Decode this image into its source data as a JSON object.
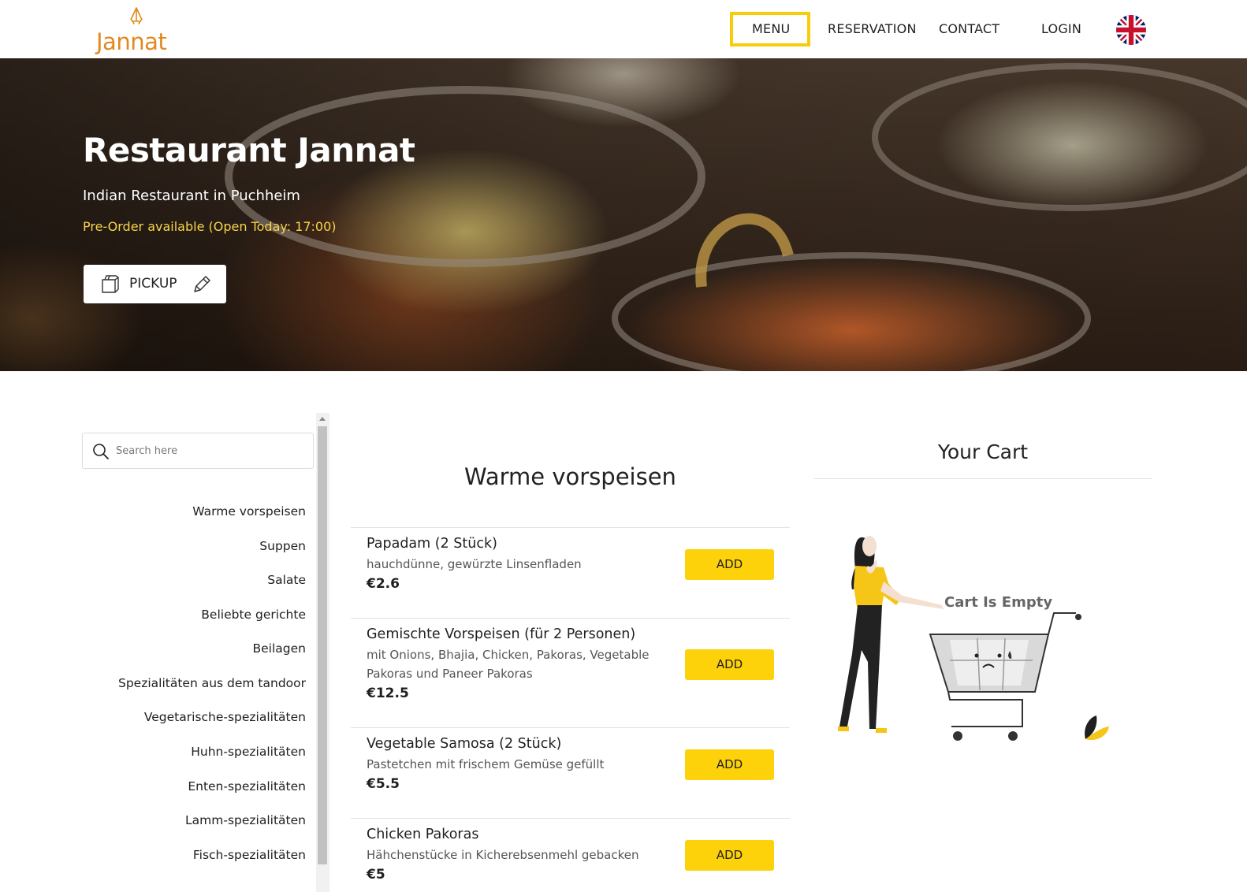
{
  "header": {
    "logo_text": "Jannat",
    "nav": {
      "menu": "MENU",
      "reservation": "RESERVATION",
      "contact": "CONTACT",
      "login": "LOGIN"
    },
    "language_icon": "uk-flag-icon"
  },
  "hero": {
    "title": "Restaurant Jannat",
    "subtitle": "Indian Restaurant in Puchheim",
    "preorder": "Pre-Order available (Open Today: 17:00)",
    "pickup_label": "PICKUP",
    "pickup_icon": "takeaway-bag-icon",
    "edit_icon": "pencil-icon"
  },
  "sidebar": {
    "search_placeholder": "Search here",
    "categories": [
      "Warme vorspeisen",
      "Suppen",
      "Salate",
      "Beliebte gerichte",
      "Beilagen",
      "Spezialitäten aus dem tandoor",
      "Vegetarische-spezialitäten",
      "Huhn-spezialitäten",
      "Enten-spezialitäten",
      "Lamm-spezialitäten",
      "Fisch-spezialitäten"
    ]
  },
  "menu": {
    "section_title": "Warme vorspeisen",
    "add_label": "ADD",
    "items": [
      {
        "name": "Papadam (2 Stück)",
        "description": "hauchdünne, gewürzte Linsenfladen",
        "price": "€2.6"
      },
      {
        "name": "Gemischte Vorspeisen (für 2 Personen)",
        "description": "mit Onions, Bhajia, Chicken, Pakoras, Vegetable Pakoras und Paneer Pakoras",
        "price": "€12.5"
      },
      {
        "name": "Vegetable Samosa (2 Stück)",
        "description": "Pastetchen mit frischem Gemüse gefüllt",
        "price": "€5.5"
      },
      {
        "name": "Chicken Pakoras",
        "description": "Hähchenstücke in Kicherebsenmehl gebacken",
        "price": "€5"
      }
    ]
  },
  "cart": {
    "title": "Your Cart",
    "empty_text": "Cart Is Empty"
  },
  "colors": {
    "accent": "#fdd20a",
    "logo": "#e08a1e",
    "preorder": "#f7d44a"
  }
}
